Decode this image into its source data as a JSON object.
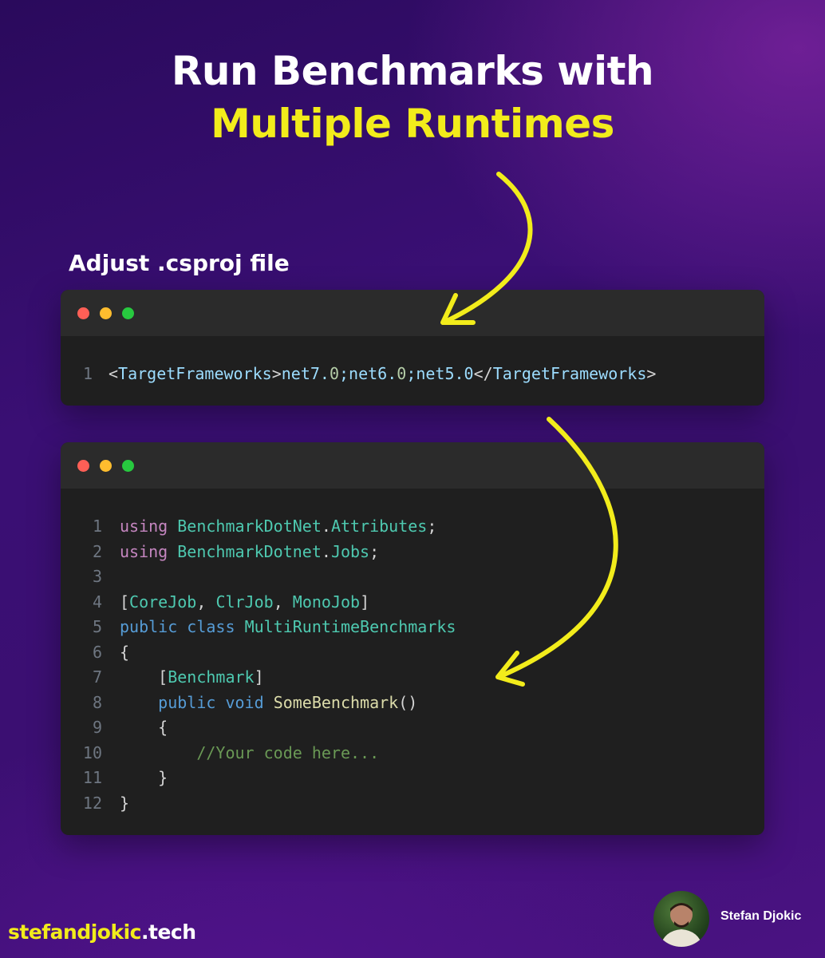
{
  "header": {
    "title_line1": "Run Benchmarks with",
    "title_line2": "Multiple Runtimes"
  },
  "subtitle": "Adjust .csproj file",
  "snippet1": {
    "lines": [
      {
        "number": "1",
        "tokens": [
          {
            "text": "<",
            "kind": "pn"
          },
          {
            "text": "TargetFrameworks",
            "kind": "tag"
          },
          {
            "text": ">",
            "kind": "pn"
          },
          {
            "text": "net7.",
            "kind": "tag"
          },
          {
            "text": "0",
            "kind": "num"
          },
          {
            "text": ";net6.",
            "kind": "tag"
          },
          {
            "text": "0",
            "kind": "num"
          },
          {
            "text": ";net5.0",
            "kind": "tag"
          },
          {
            "text": "</",
            "kind": "pn"
          },
          {
            "text": "TargetFrameworks",
            "kind": "tag"
          },
          {
            "text": ">",
            "kind": "pn"
          }
        ]
      }
    ]
  },
  "snippet2": {
    "lines": [
      {
        "number": "1",
        "tokens": [
          {
            "text": "using",
            "kind": "kw"
          },
          {
            "text": " ",
            "kind": "pn"
          },
          {
            "text": "BenchmarkDotNet",
            "kind": "type"
          },
          {
            "text": ".",
            "kind": "pn"
          },
          {
            "text": "Attributes",
            "kind": "type"
          },
          {
            "text": ";",
            "kind": "pn"
          }
        ]
      },
      {
        "number": "2",
        "tokens": [
          {
            "text": "using",
            "kind": "kw"
          },
          {
            "text": " ",
            "kind": "pn"
          },
          {
            "text": "BenchmarkDotnet",
            "kind": "type"
          },
          {
            "text": ".",
            "kind": "pn"
          },
          {
            "text": "Jobs",
            "kind": "type"
          },
          {
            "text": ";",
            "kind": "pn"
          }
        ]
      },
      {
        "number": "3",
        "tokens": []
      },
      {
        "number": "4",
        "tokens": [
          {
            "text": "[",
            "kind": "pn"
          },
          {
            "text": "CoreJob",
            "kind": "attr"
          },
          {
            "text": ", ",
            "kind": "pn"
          },
          {
            "text": "ClrJob",
            "kind": "attr"
          },
          {
            "text": ", ",
            "kind": "pn"
          },
          {
            "text": "MonoJob",
            "kind": "attr"
          },
          {
            "text": "]",
            "kind": "pn"
          }
        ]
      },
      {
        "number": "5",
        "tokens": [
          {
            "text": "public",
            "kind": "kw2"
          },
          {
            "text": " ",
            "kind": "pn"
          },
          {
            "text": "class",
            "kind": "kw2"
          },
          {
            "text": " ",
            "kind": "pn"
          },
          {
            "text": "MultiRuntimeBenchmarks",
            "kind": "type"
          }
        ]
      },
      {
        "number": "6",
        "tokens": [
          {
            "text": "{",
            "kind": "pn"
          }
        ]
      },
      {
        "number": "7",
        "tokens": [
          {
            "text": "    [",
            "kind": "pn"
          },
          {
            "text": "Benchmark",
            "kind": "attr"
          },
          {
            "text": "]",
            "kind": "pn"
          }
        ]
      },
      {
        "number": "8",
        "tokens": [
          {
            "text": "    ",
            "kind": "pn"
          },
          {
            "text": "public",
            "kind": "kw2"
          },
          {
            "text": " ",
            "kind": "pn"
          },
          {
            "text": "void",
            "kind": "kw2"
          },
          {
            "text": " ",
            "kind": "pn"
          },
          {
            "text": "SomeBenchmark",
            "kind": "fn"
          },
          {
            "text": "()",
            "kind": "pn"
          }
        ]
      },
      {
        "number": "9",
        "tokens": [
          {
            "text": "    {",
            "kind": "pn"
          }
        ]
      },
      {
        "number": "10",
        "tokens": [
          {
            "text": "        ",
            "kind": "pn"
          },
          {
            "text": "//Your code here...",
            "kind": "cm"
          }
        ]
      },
      {
        "number": "11",
        "tokens": [
          {
            "text": "    }",
            "kind": "pn"
          }
        ]
      },
      {
        "number": "12",
        "tokens": [
          {
            "text": "}",
            "kind": "pn"
          }
        ]
      }
    ]
  },
  "footer": {
    "site_name": "stefandjokic",
    "site_suffix": ".tech",
    "author": "Stefan Djokic"
  },
  "colors": {
    "accent_yellow": "#f2ec1b",
    "window_bg": "#1f1f1f",
    "titlebar_bg": "#2b2b2b"
  }
}
